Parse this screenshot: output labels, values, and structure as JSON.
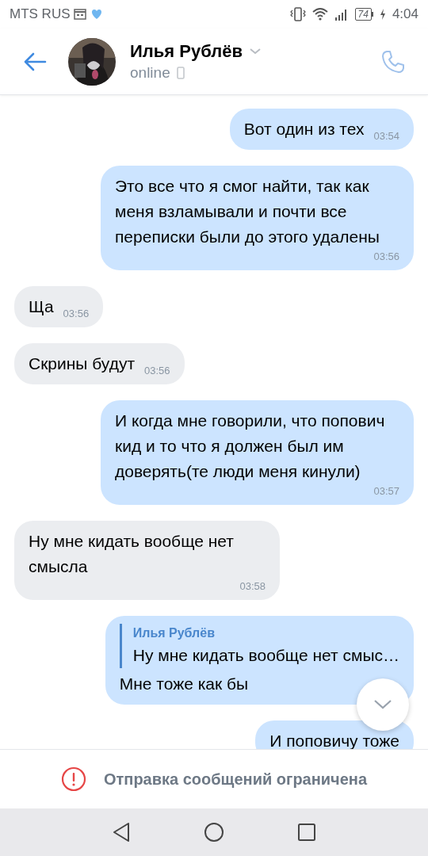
{
  "status_bar": {
    "carrier": "MTS RUS",
    "battery": "74",
    "time": "4:04"
  },
  "header": {
    "name": "Илья Рублёв",
    "presence": "online"
  },
  "messages": [
    {
      "outgoing": true,
      "text": "Вот один из тех",
      "time": "03:54"
    },
    {
      "outgoing": true,
      "text": "Это все что я смог найти, так как меня взламывали и почти все переписки были до этого удалены",
      "time": "03:56"
    },
    {
      "outgoing": false,
      "text": "Ща",
      "time": "03:56"
    },
    {
      "outgoing": false,
      "text": "Скрины будут",
      "time": "03:56"
    },
    {
      "outgoing": true,
      "text": "И когда мне говорили, что попович кид и то что я должен был им доверять(те люди меня кинули)",
      "time": "03:57"
    },
    {
      "outgoing": false,
      "text": "Ну мне кидать вообще нет смысла",
      "time": "03:58"
    },
    {
      "outgoing": true,
      "reply": {
        "author": "Илья Рублёв",
        "text": "Ну мне кидать вообще нет смыс…"
      },
      "text": "Мне тоже как бы"
    },
    {
      "outgoing": true,
      "text": "И поповичу тоже"
    }
  ],
  "footer": {
    "notice": "Отправка сообщений ограничена"
  }
}
